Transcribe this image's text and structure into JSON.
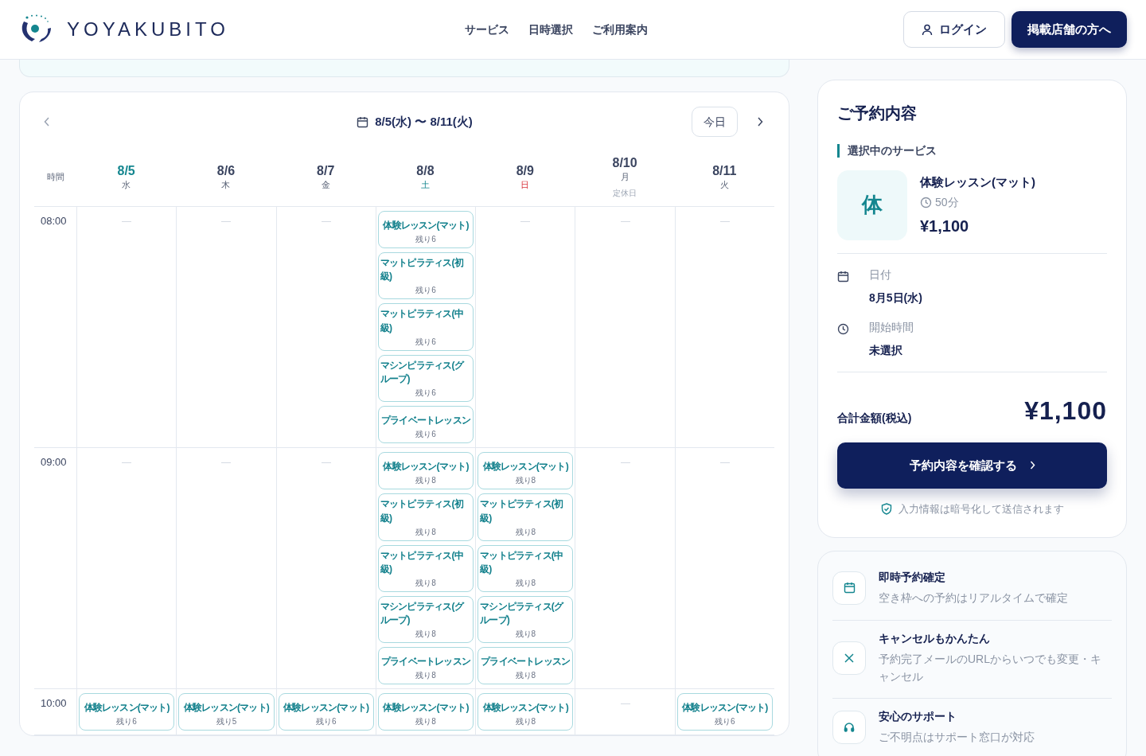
{
  "header": {
    "logo_text": "YOYAKUBITO",
    "nav": [
      "サービス",
      "日時選択",
      "ご利用案内"
    ],
    "login_button": "ログイン",
    "merchant_button": "掲載店舗の方へ"
  },
  "calendar": {
    "range": "8/5(水) 〜 8/11(火)",
    "today_button": "今日",
    "time_heading": "時間",
    "days": [
      {
        "date": "8/5",
        "weekday": "水",
        "kind": "weekday",
        "selected": true
      },
      {
        "date": "8/6",
        "weekday": "木",
        "kind": "weekday",
        "selected": false
      },
      {
        "date": "8/7",
        "weekday": "金",
        "kind": "weekday",
        "selected": false
      },
      {
        "date": "8/8",
        "weekday": "土",
        "kind": "saturday",
        "selected": false
      },
      {
        "date": "8/9",
        "weekday": "日",
        "kind": "sunday",
        "selected": false
      },
      {
        "date": "8/10",
        "weekday": "月",
        "kind": "weekday",
        "selected": false,
        "note": "定休日"
      },
      {
        "date": "8/11",
        "weekday": "火",
        "kind": "weekday",
        "selected": false
      }
    ],
    "rows": [
      {
        "time": "08:00",
        "cells": [
          [],
          [],
          [],
          [
            {
              "name": "体験レッスン(マット)",
              "remaining": "残り6"
            },
            {
              "name": "マットピラティス(初級)",
              "remaining": "残り6"
            },
            {
              "name": "マットピラティス(中級)",
              "remaining": "残り6"
            },
            {
              "name": "マシンピラティス(グループ)",
              "remaining": "残り6"
            },
            {
              "name": "プライベートレッスン",
              "remaining": "残り6"
            }
          ],
          [],
          [],
          []
        ]
      },
      {
        "time": "09:00",
        "cells": [
          [],
          [],
          [],
          [
            {
              "name": "体験レッスン(マット)",
              "remaining": "残り8"
            },
            {
              "name": "マットピラティス(初級)",
              "remaining": "残り8"
            },
            {
              "name": "マットピラティス(中級)",
              "remaining": "残り8"
            },
            {
              "name": "マシンピラティス(グループ)",
              "remaining": "残り8"
            },
            {
              "name": "プライベートレッスン",
              "remaining": "残り8"
            }
          ],
          [
            {
              "name": "体験レッスン(マット)",
              "remaining": "残り8"
            },
            {
              "name": "マットピラティス(初級)",
              "remaining": "残り8"
            },
            {
              "name": "マットピラティス(中級)",
              "remaining": "残り8"
            },
            {
              "name": "マシンピラティス(グループ)",
              "remaining": "残り8"
            },
            {
              "name": "プライベートレッスン",
              "remaining": "残り8"
            }
          ],
          [],
          []
        ]
      },
      {
        "time": "10:00",
        "cells": [
          [
            {
              "name": "体験レッスン(マット)",
              "remaining": "残り6"
            }
          ],
          [
            {
              "name": "体験レッスン(マット)",
              "remaining": "残り5"
            }
          ],
          [
            {
              "name": "体験レッスン(マット)",
              "remaining": "残り6"
            }
          ],
          [
            {
              "name": "体験レッスン(マット)",
              "remaining": "残り8"
            }
          ],
          [
            {
              "name": "体験レッスン(マット)",
              "remaining": "残り8"
            }
          ],
          [],
          [
            {
              "name": "体験レッスン(マット)",
              "remaining": "残り6"
            }
          ]
        ]
      }
    ]
  },
  "summary": {
    "title": "ご予約内容",
    "section_label": "選択中のサービス",
    "service": {
      "initial": "体",
      "name": "体験レッスン(マット)",
      "duration": "50分",
      "price": "¥1,100"
    },
    "details": [
      {
        "kind": "date",
        "label": "日付",
        "value": "8月5日(水)"
      },
      {
        "kind": "time",
        "label": "開始時間",
        "value": "未選択"
      }
    ],
    "total_label": "合計金額(税込)",
    "total": "¥1,100",
    "confirm_button": "予約内容を確認する",
    "secure_note": "入力情報は暗号化して送信されます"
  },
  "features": [
    {
      "kind": "calendar",
      "title": "即時予約確定",
      "text": "空き枠への予約はリアルタイムで確定"
    },
    {
      "kind": "cancel",
      "title": "キャンセルもかんたん",
      "text": "予約完了メールのURLからいつでも変更・キャンセル"
    },
    {
      "kind": "support",
      "title": "安心のサポート",
      "text": "ご不明点はサポート窓口が対応"
    }
  ]
}
